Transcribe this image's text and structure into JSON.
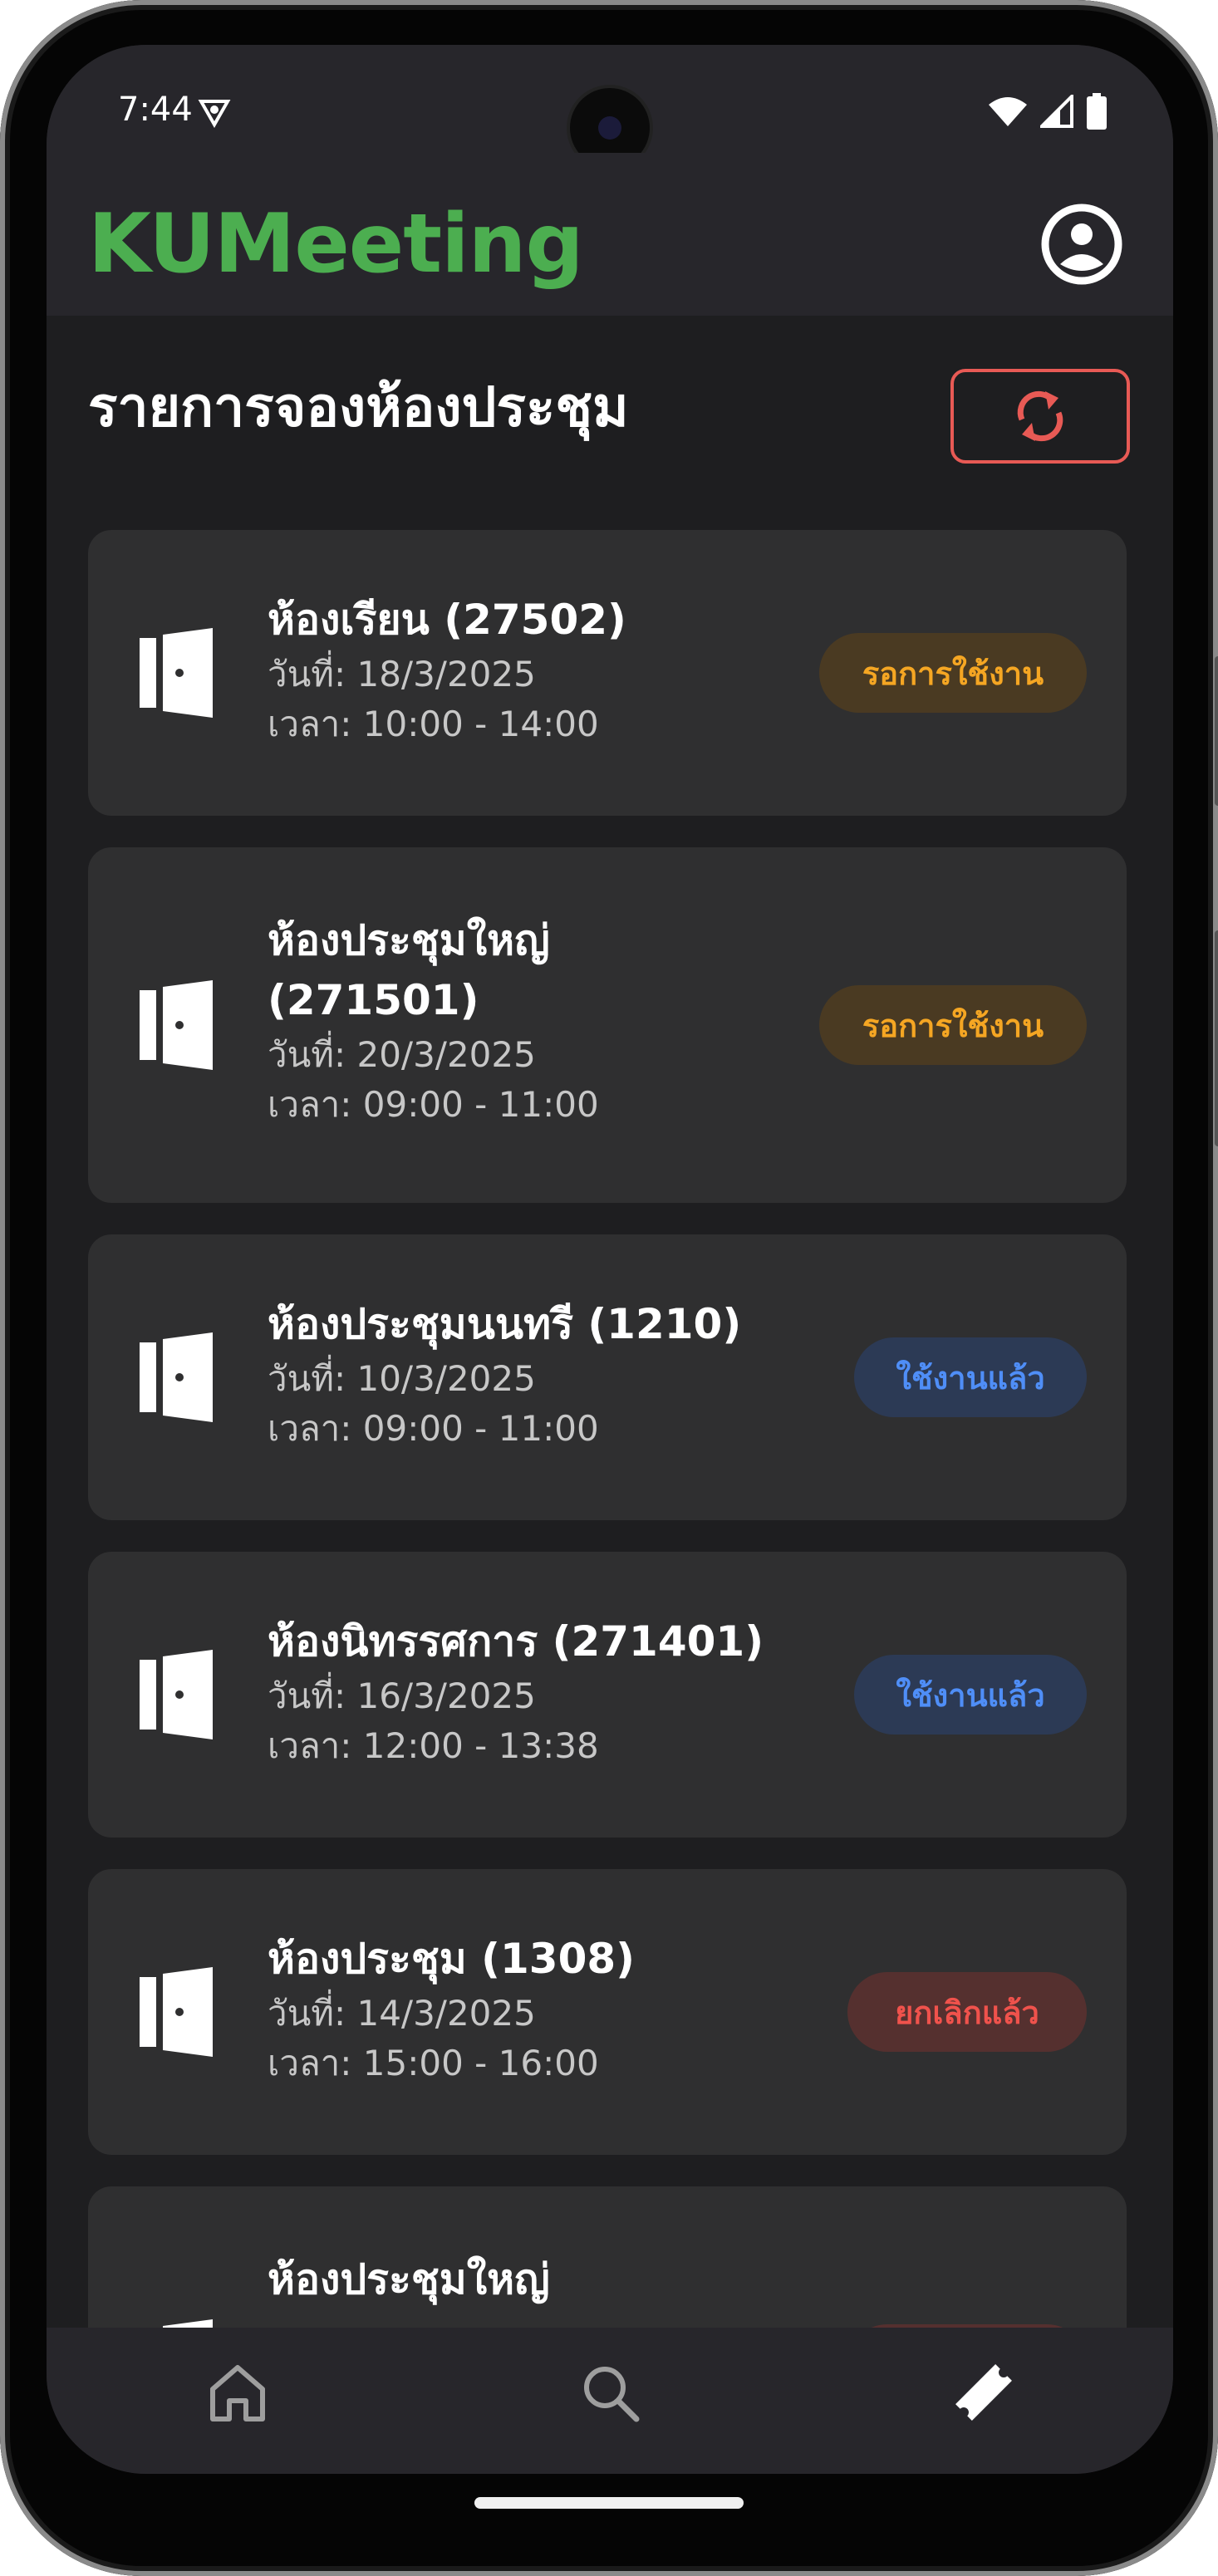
{
  "status_bar": {
    "time": "7:44"
  },
  "app": {
    "title": "KUMeeting",
    "brand_color": "#4cae50"
  },
  "page": {
    "title": "รายการจองห้องประชุม"
  },
  "bookings": [
    {
      "room": "ห้องเรียน (27502)",
      "date": "วันที่: 18/3/2025",
      "time": "เวลา: 10:00 - 14:00",
      "status": "รอการใช้งาน",
      "status_type": "pending"
    },
    {
      "room": "ห้องประชุมใหญ่ (271501)",
      "date": "วันที่: 20/3/2025",
      "time": "เวลา: 09:00 - 11:00",
      "status": "รอการใช้งาน",
      "status_type": "pending"
    },
    {
      "room": "ห้องประชุมนนทรี (1210)",
      "date": "วันที่: 10/3/2025",
      "time": "เวลา: 09:00 - 11:00",
      "status": "ใช้งานแล้ว",
      "status_type": "used"
    },
    {
      "room": "ห้องนิทรรศการ (271401)",
      "date": "วันที่: 16/3/2025",
      "time": "เวลา: 12:00 - 13:38",
      "status": "ใช้งานแล้ว",
      "status_type": "used"
    },
    {
      "room": "ห้องประชุม (1308)",
      "date": "วันที่: 14/3/2025",
      "time": "เวลา: 15:00 - 16:00",
      "status": "ยกเลิกแล้ว",
      "status_type": "cancelled"
    },
    {
      "room": "ห้องประชุมใหญ่",
      "date": "",
      "time": "",
      "status": "",
      "status_type": "cancelled"
    }
  ],
  "status_colors": {
    "pending": {
      "text": "#f5a623",
      "bg": "#4a3a22"
    },
    "used": {
      "text": "#4f8ef7",
      "bg": "#2c3a55"
    },
    "cancelled": {
      "text": "#f0524c",
      "bg": "#55302f"
    }
  },
  "icons": {
    "refresh": "refresh-icon",
    "profile": "profile-icon",
    "room": "door-icon",
    "nav_home": "home-icon",
    "nav_search": "search-icon",
    "nav_bookings": "ticket-icon"
  }
}
